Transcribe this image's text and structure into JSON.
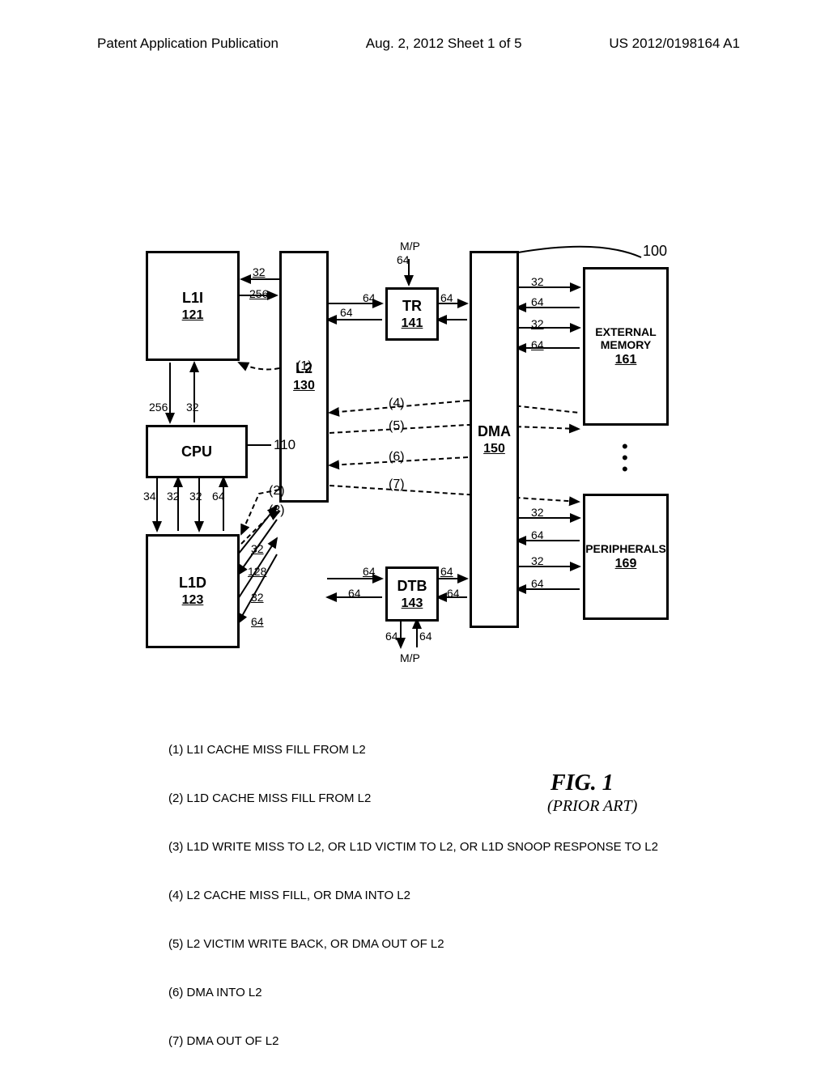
{
  "header": {
    "left": "Patent Application Publication",
    "center": "Aug. 2, 2012  Sheet 1 of 5",
    "right": "US 2012/0198164 A1"
  },
  "boxes": {
    "l1i": {
      "title": "L1I",
      "ref": "121"
    },
    "l2": {
      "title": "L2",
      "ref": "130"
    },
    "cpu": {
      "title": "CPU"
    },
    "l1d": {
      "title": "L1D",
      "ref": "123"
    },
    "tr": {
      "title": "TR",
      "ref": "141"
    },
    "dtb": {
      "title": "DTB",
      "ref": "143"
    },
    "dma": {
      "title": "DMA",
      "ref": "150"
    },
    "ext": {
      "title": "EXTERNAL MEMORY",
      "ref": "161"
    },
    "per": {
      "title": "PERIPHERALS",
      "ref": "169"
    }
  },
  "labels": {
    "lead100": "100",
    "lead110": "110",
    "mp_top": "M/P",
    "mp_bottom": "M/P",
    "w256a": "256",
    "w256b": "256",
    "w128": "128",
    "w64": "64",
    "w32": "32",
    "w34": "34"
  },
  "parens": {
    "p1": "(1)",
    "p2": "(2)",
    "p3": "(3)",
    "p4": "(4)",
    "p5": "(5)",
    "p6": "(6)",
    "p7": "(7)"
  },
  "legend": {
    "l1": "(1) L1I CACHE MISS FILL FROM L2",
    "l2": "(2) L1D CACHE MISS FILL FROM L2",
    "l3": "(3) L1D WRITE MISS TO L2, OR L1D VICTIM TO L2, OR L1D SNOOP RESPONSE TO L2",
    "l4": "(4) L2 CACHE MISS FILL, OR DMA INTO L2",
    "l5": "(5) L2 VICTIM WRITE BACK, OR DMA OUT OF L2",
    "l6": "(6) DMA INTO L2",
    "l7": "(7) DMA OUT OF L2"
  },
  "figure": {
    "title": "FIG.  1",
    "sub": "(PRIOR ART)"
  }
}
